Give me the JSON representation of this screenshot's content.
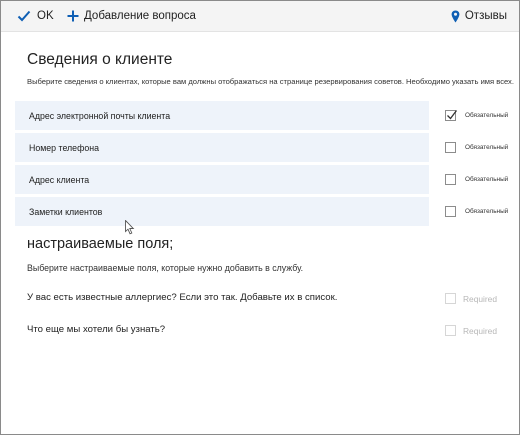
{
  "toolbar": {
    "ok_label": "OK",
    "add_question_label": "Добавление вопроса",
    "feedback_label": "Отзывы"
  },
  "customer_info": {
    "title": "Сведения о клиенте",
    "description": "Выберите сведения о клиентах, которые вам должны отображаться на странице резервирования советов. Необходимо указать имя всех.",
    "rows": [
      {
        "label": "Адрес электронной почты клиента",
        "required_label": "Обязательный",
        "checked": true
      },
      {
        "label": "Номер телефона",
        "required_label": "Обязательный",
        "checked": false
      },
      {
        "label": "Адрес клиента",
        "required_label": "Обязательный",
        "checked": false
      },
      {
        "label": "Заметки клиентов",
        "required_label": "Обязательный",
        "checked": false
      }
    ]
  },
  "custom_fields": {
    "title": "настраиваемые поля;",
    "description": "Выберите настраиваемые поля, которые нужно добавить в службу.",
    "questions": [
      {
        "label": "У вас есть известные аллергиес? Если это так. Добавьте их в список.",
        "required_label": "Required",
        "checked": false
      },
      {
        "label": "Что еще мы хотели бы узнать?",
        "required_label": "Required",
        "checked": false
      }
    ]
  },
  "colors": {
    "accent": "#0f5fb4",
    "row_background": "#eef3fa",
    "toolbar_background": "#f4f4f4"
  },
  "icons": {
    "ok": "checkmark-icon",
    "add": "plus-icon",
    "feedback": "location-pin-icon",
    "pointer": "mouse-cursor-icon"
  }
}
